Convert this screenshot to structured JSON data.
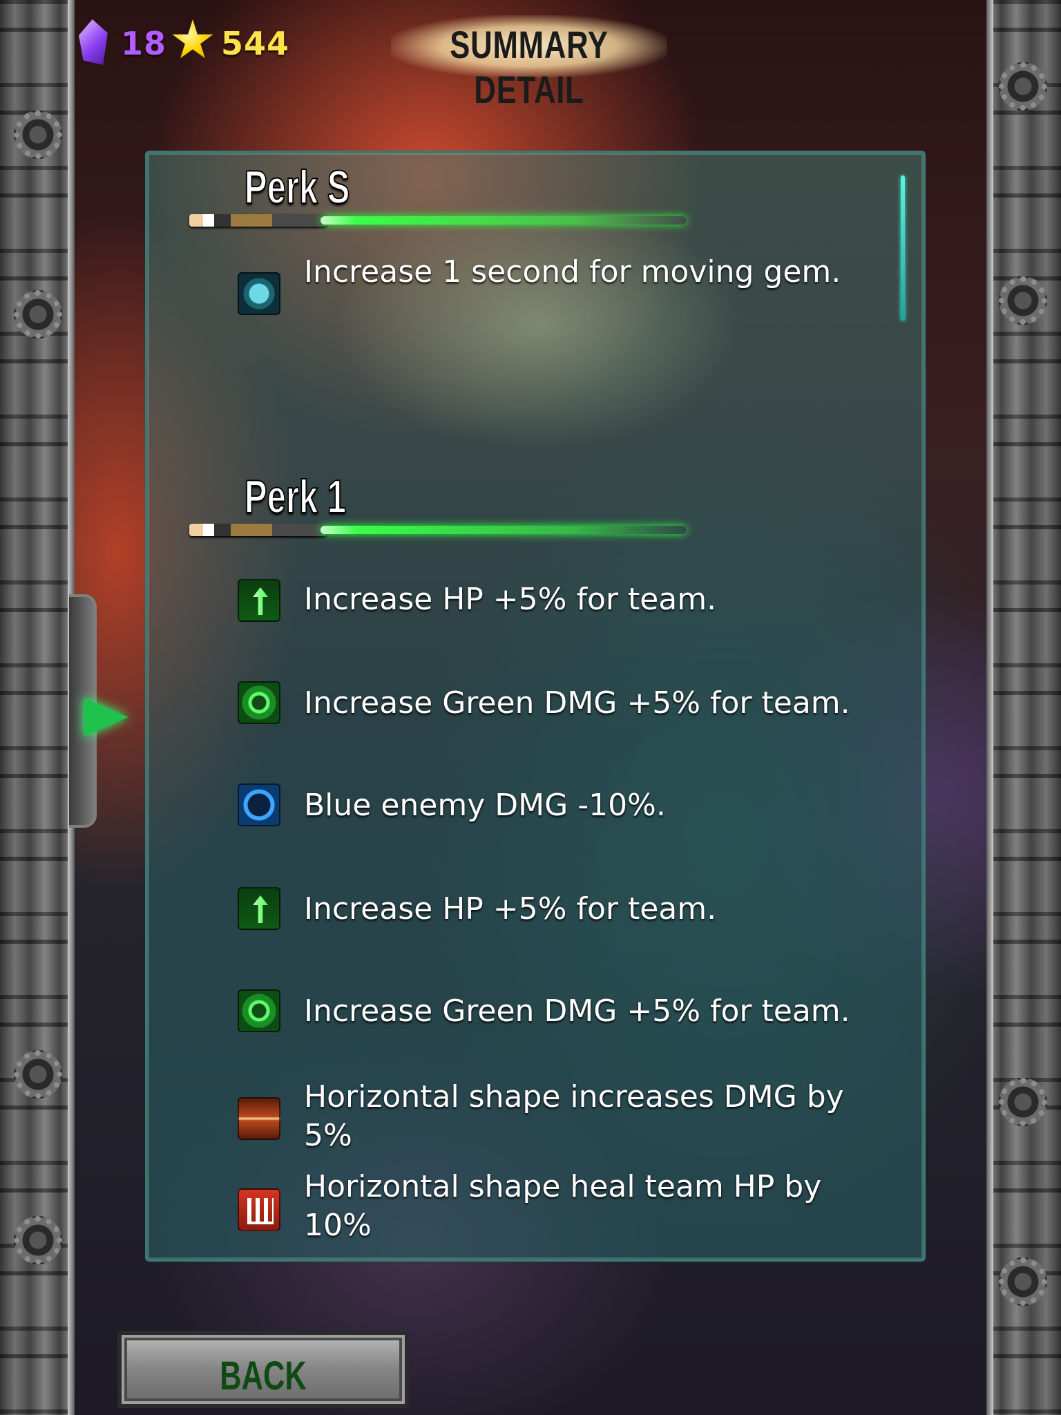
{
  "header": {
    "gems": "18",
    "stars": "544",
    "title": "SUMMARY DETAIL"
  },
  "perks": [
    {
      "title": "Perk S",
      "items": [
        {
          "icon": "hourglass-icon",
          "text": "Increase 1 second for moving gem."
        }
      ]
    },
    {
      "title": "Perk 1",
      "items": [
        {
          "icon": "hp-up-icon",
          "text": "Increase HP +5% for team."
        },
        {
          "icon": "green-dmg-icon",
          "text": "Increase Green DMG +5% for team."
        },
        {
          "icon": "blue-orb-icon",
          "text": "Blue enemy DMG -10%."
        },
        {
          "icon": "hp-up-icon",
          "text": "Increase HP +5%  for team."
        },
        {
          "icon": "green-dmg-icon",
          "text": "Increase Green DMG +5% for team."
        },
        {
          "icon": "horizontal-dmg-icon",
          "text": "Horizontal shape increases DMG by 5%"
        },
        {
          "icon": "horizontal-heal-icon",
          "text": "Horizontal shape heal team HP by 10%"
        }
      ]
    }
  ],
  "footer": {
    "back_label": "BACK"
  },
  "colors": {
    "gems": "#b35cff",
    "stars": "#ffe34a",
    "saber": "#39ff48",
    "panel_border": "#3d7772"
  }
}
